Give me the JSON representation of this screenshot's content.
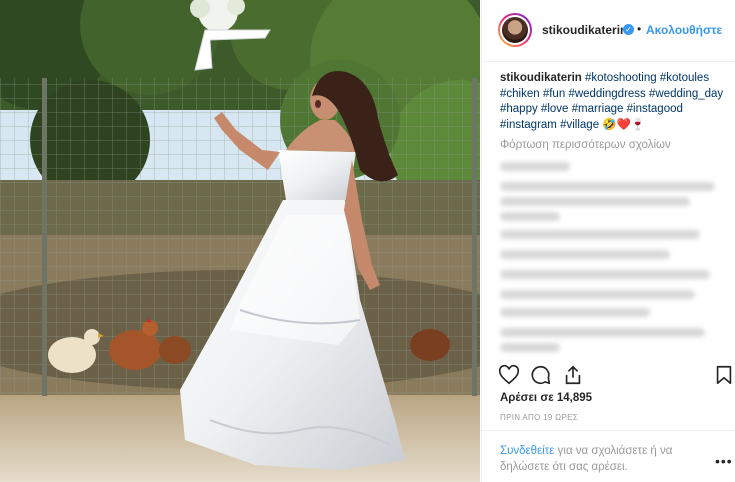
{
  "post": {
    "username": "stikoudikaterin",
    "follow_label": "Ακολουθήστε",
    "dot": "•",
    "caption_user": "stikoudikaterin",
    "hashtags": [
      "#kotoshooting",
      "#kotoules",
      "#chiken",
      "#fun",
      "#weddingdress",
      "#wedding_day",
      "#happy",
      "#love",
      "#marriage",
      "#instagood",
      "#instagram",
      "#village"
    ],
    "caption_emoji": "🤣❤️🍷",
    "load_more": "Φόρτωση περισσότερων σχολίων",
    "likes": "Αρέσει σε 14,895",
    "time_ago": "ΠΡΙΝ ΑΠΟ 19 ΩΡΕΣ",
    "login_link": "Συνδεθείτε",
    "login_text": " για να σχολιάσετε ή να δηλώσετε ότι σας αρέσει.",
    "more_options": "•••"
  },
  "icons": {
    "like": "heart-icon",
    "comment": "comment-icon",
    "share": "share-icon",
    "save": "bookmark-icon",
    "verified": "verified-badge-icon"
  },
  "colors": {
    "link": "#3897f0",
    "hashtag": "#003569",
    "muted": "#999999",
    "text": "#262626"
  }
}
